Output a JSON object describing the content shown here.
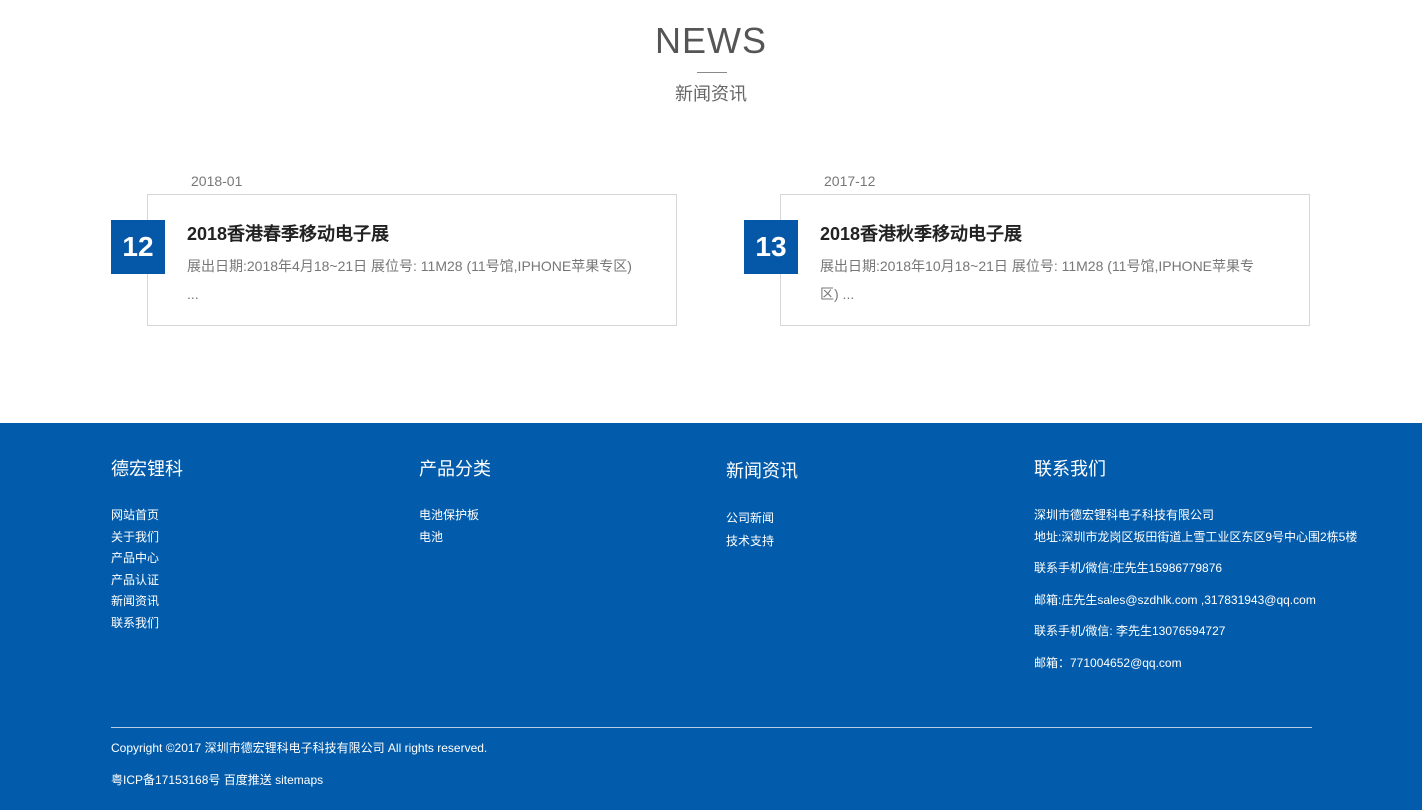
{
  "news_section": {
    "title": "NEWS",
    "subtitle": "新闻资讯",
    "items": [
      {
        "month": "2018-01",
        "day": "12",
        "title": "2018香港春季移动电子展",
        "summary": "展出日期:2018年4月18~21日 展位号: 11M28 (11号馆,IPHONE苹果专区) ..."
      },
      {
        "month": "2017-12",
        "day": "13",
        "title": "2018香港秋季移动电子展",
        "summary": "展出日期:2018年10月18~21日 展位号: 11M28 (11号馆,IPHONE苹果专区) ..."
      }
    ]
  },
  "footer": {
    "background_color": "#035cab",
    "columns": [
      {
        "heading": "德宏锂科",
        "links": [
          "网站首页",
          "关于我们",
          "产品中心",
          "产品认证",
          "新闻资讯",
          "联系我们"
        ]
      },
      {
        "heading": "产品分类",
        "links": [
          "电池保护板",
          "电池"
        ]
      },
      {
        "heading": "新闻资讯",
        "links": [
          "公司新闻",
          "技术支持"
        ]
      },
      {
        "heading": "联系我们",
        "company": "深圳市德宏锂科电子科技有限公司",
        "address": "地址:深圳市龙岗区坂田街道上雪工业区东区9号中心围2栋5楼",
        "contact_1": "联系手机/微信:庄先生15986779876",
        "email_1": "邮箱:庄先生sales@szdhlk.com ,317831943@qq.com",
        "contact_2": "联系手机/微信: 李先生13076594727",
        "email_2": "邮箱：771004652@qq.com"
      }
    ],
    "copyright": "Copyright ©2017 深圳市德宏锂科电子科技有限公司 All rights reserved.",
    "icp": "粤ICP备17153168号",
    "baidu_push": "百度推送",
    "sitemaps": "sitemaps"
  },
  "colors": {
    "accent": "#0557a8",
    "footer_bg": "#035cab",
    "card_border": "#d6d6d6"
  }
}
